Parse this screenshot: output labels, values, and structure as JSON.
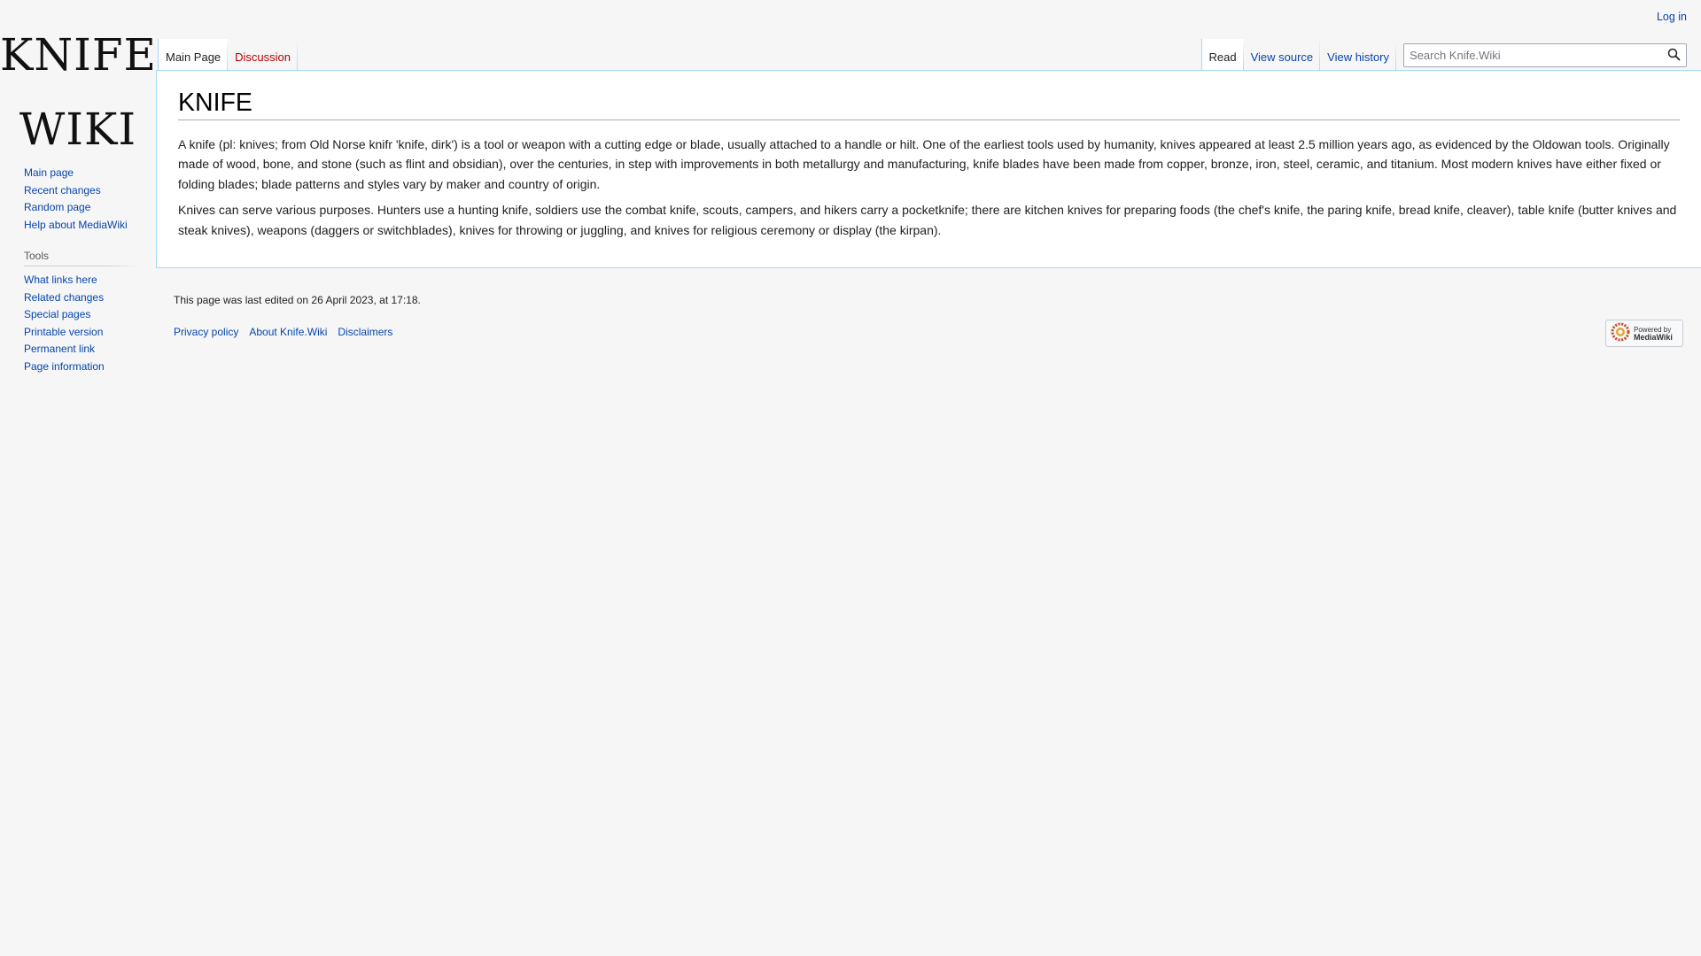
{
  "logo": {
    "line1": "KNIFE",
    "line2": "WIKI"
  },
  "personal": {
    "login": "Log in"
  },
  "sidebar": {
    "navigation": [
      {
        "label": "Main page"
      },
      {
        "label": "Recent changes"
      },
      {
        "label": "Random page"
      },
      {
        "label": "Help about MediaWiki"
      }
    ],
    "tools_heading": "Tools",
    "tools": [
      {
        "label": "What links here"
      },
      {
        "label": "Related changes"
      },
      {
        "label": "Special pages"
      },
      {
        "label": "Printable version"
      },
      {
        "label": "Permanent link"
      },
      {
        "label": "Page information"
      }
    ]
  },
  "tabs": {
    "left": [
      {
        "label": "Main Page"
      },
      {
        "label": "Discussion"
      }
    ],
    "right": [
      {
        "label": "Read"
      },
      {
        "label": "View source"
      },
      {
        "label": "View history"
      }
    ]
  },
  "search": {
    "placeholder": "Search Knife.Wiki"
  },
  "page": {
    "title": "KNIFE",
    "paragraphs": [
      "A knife (pl: knives; from Old Norse knifr 'knife, dirk') is a tool or weapon with a cutting edge or blade, usually attached to a handle or hilt. One of the earliest tools used by humanity, knives appeared at least 2.5 million years ago, as evidenced by the Oldowan tools. Originally made of wood, bone, and stone (such as flint and obsidian), over the centuries, in step with improvements in both metallurgy and manufacturing, knife blades have been made from copper, bronze, iron, steel, ceramic, and titanium. Most modern knives have either fixed or folding blades; blade patterns and styles vary by maker and country of origin.",
      "Knives can serve various purposes. Hunters use a hunting knife, soldiers use the combat knife, scouts, campers, and hikers carry a pocketknife; there are kitchen knives for preparing foods (the chef's knife, the paring knife, bread knife, cleaver), table knife (butter knives and steak knives), weapons (daggers or switchblades), knives for throwing or juggling, and knives for religious ceremony or display (the kirpan)."
    ]
  },
  "footer": {
    "lastmod": "This page was last edited on 26 April 2023, at 17:18.",
    "links": [
      {
        "label": "Privacy policy"
      },
      {
        "label": "About Knife.Wiki"
      },
      {
        "label": "Disclaimers"
      }
    ],
    "powered_by": {
      "line1": "Powered by",
      "line2": "MediaWiki"
    }
  },
  "colors": {
    "link": "#0645ad",
    "new_link": "#ba0000",
    "tab_border": "#a7d7f9",
    "page_bg": "#f6f6f6"
  }
}
